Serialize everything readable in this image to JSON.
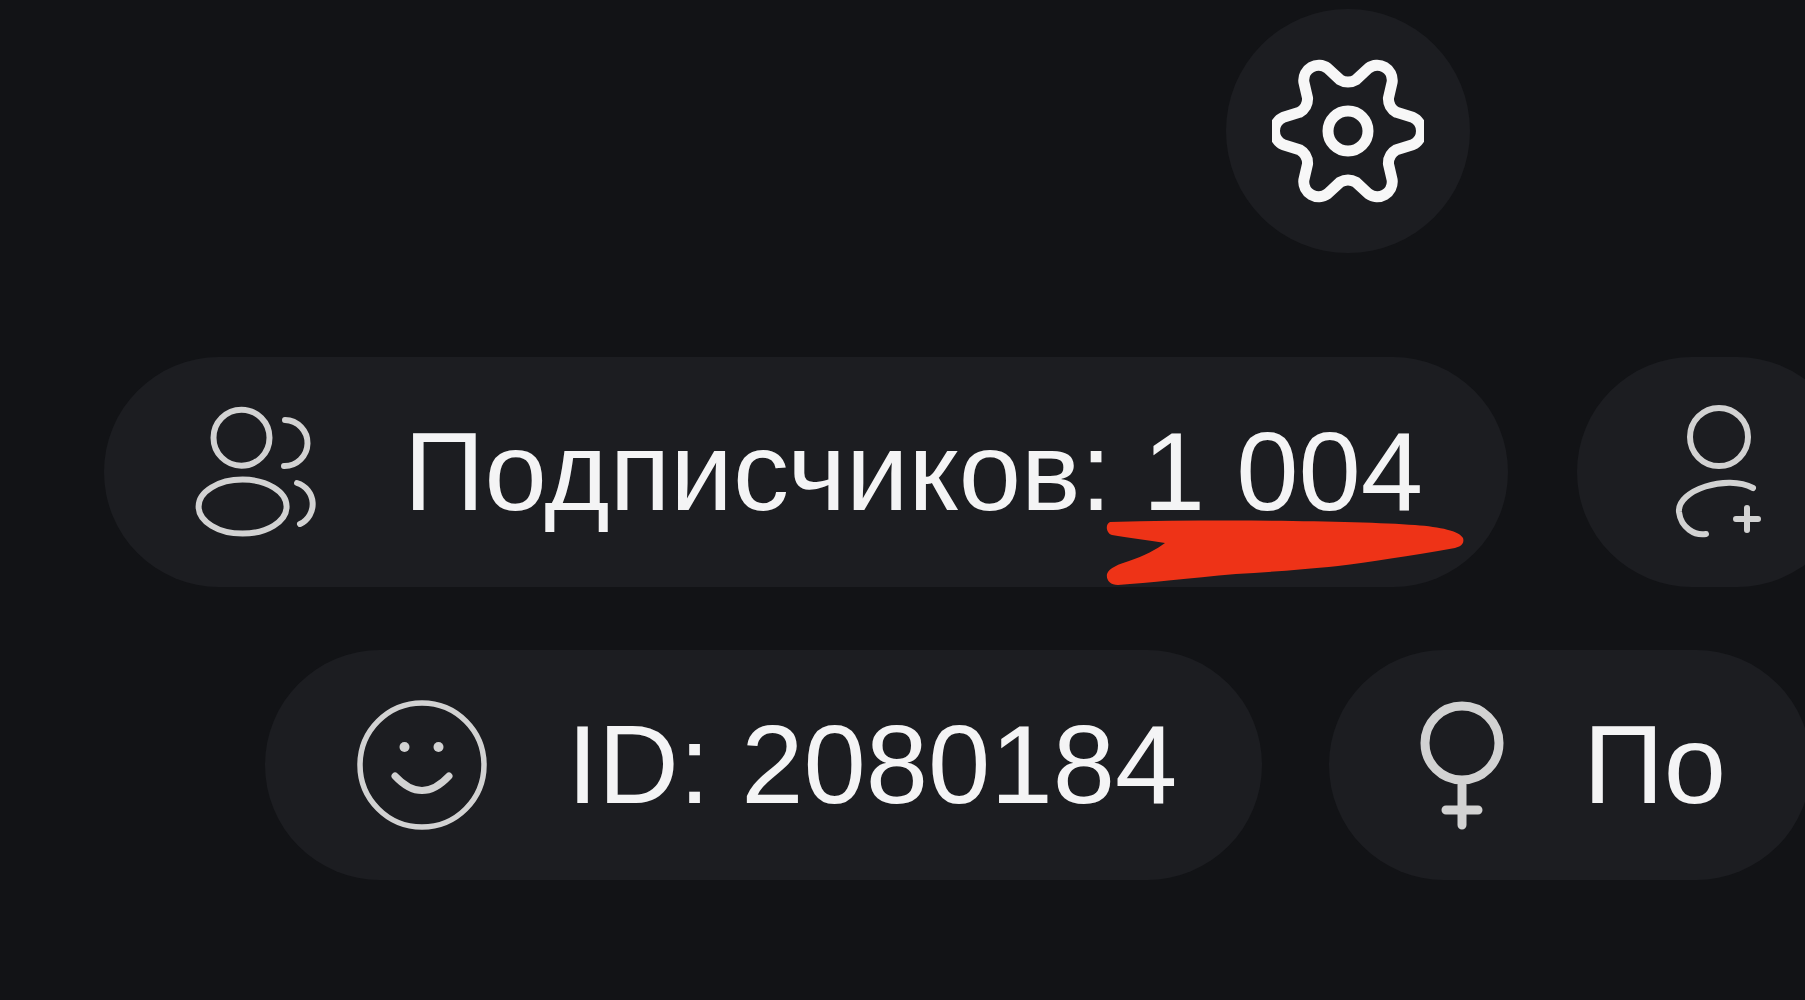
{
  "rows": [
    {
      "chips": [
        {
          "kind": "followers",
          "label": "Подписчиков: 1 004",
          "marked": true
        },
        {
          "kind": "add",
          "marked": false
        }
      ]
    },
    {
      "chips": [
        {
          "kind": "id",
          "label": "ID: 2080184",
          "marked": false
        },
        {
          "kind": "gender",
          "label": "По",
          "marked": false
        }
      ]
    }
  ]
}
